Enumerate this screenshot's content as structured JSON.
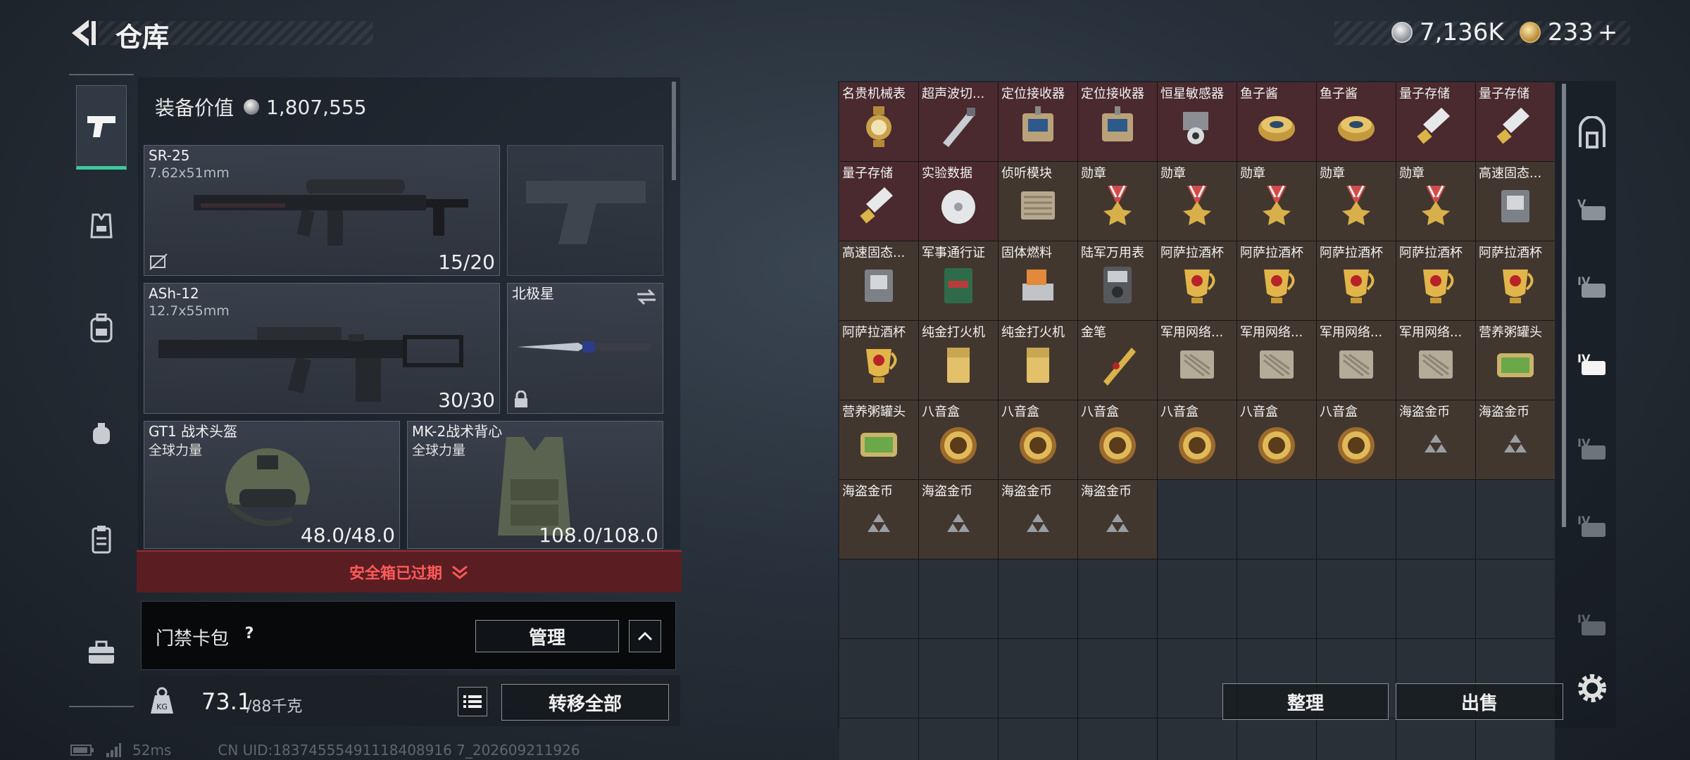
{
  "header": {
    "title": "仓库",
    "currency_1": "7,136K",
    "currency_2": "233",
    "add_label": "+"
  },
  "loadout": {
    "equip_value_label": "装备价值",
    "equip_value": "1,807,555",
    "primary": {
      "name": "SR-25",
      "caliber": "7.62x51mm",
      "ammo": "15/20"
    },
    "secondary": {
      "name": "ASh-12",
      "caliber": "12.7x55mm",
      "ammo": "30/30"
    },
    "melee": {
      "name": "北极星"
    },
    "helmet": {
      "name": "GT1 战术头盔",
      "faction": "全球力量",
      "durability": "48.0/48.0"
    },
    "vest": {
      "name": "MK-2战术背心",
      "faction": "全球力量",
      "durability": "108.0/108.0"
    },
    "safebox_status": "安全箱已过期",
    "card_pack_label": "门禁卡包",
    "card_pack_help": "?",
    "manage_label": "管理",
    "weight_current": "73.1",
    "weight_max": "/88千克",
    "transfer_all_label": "转移全部"
  },
  "storage": {
    "items": [
      {
        "name": "名贵机械表",
        "bg": "red",
        "icon": "watch-icon"
      },
      {
        "name": "超声波切...",
        "bg": "red",
        "icon": "scalpel-icon"
      },
      {
        "name": "定位接收器",
        "bg": "red",
        "icon": "receiver-icon"
      },
      {
        "name": "定位接收器",
        "bg": "red",
        "icon": "receiver-icon"
      },
      {
        "name": "恒星敏感器",
        "bg": "red",
        "icon": "sensor-icon"
      },
      {
        "name": "鱼子酱",
        "bg": "red",
        "icon": "caviar-icon"
      },
      {
        "name": "鱼子酱",
        "bg": "red",
        "icon": "caviar-icon"
      },
      {
        "name": "量子存储",
        "bg": "red",
        "icon": "quantum-storage-icon"
      },
      {
        "name": "量子存储",
        "bg": "red",
        "icon": "quantum-storage-icon"
      },
      {
        "name": "量子存储",
        "bg": "red",
        "icon": "quantum-storage-icon"
      },
      {
        "name": "实验数据",
        "bg": "red",
        "icon": "disc-icon"
      },
      {
        "name": "侦听模块",
        "bg": "brown",
        "icon": "module-icon"
      },
      {
        "name": "勋章",
        "bg": "brown",
        "icon": "medal-icon"
      },
      {
        "name": "勋章",
        "bg": "brown",
        "icon": "medal-icon"
      },
      {
        "name": "勋章",
        "bg": "brown",
        "icon": "medal-icon"
      },
      {
        "name": "勋章",
        "bg": "brown",
        "icon": "medal-icon"
      },
      {
        "name": "勋章",
        "bg": "brown",
        "icon": "medal-icon"
      },
      {
        "name": "高速固态...",
        "bg": "brown",
        "icon": "ssd-icon"
      },
      {
        "name": "高速固态...",
        "bg": "brown",
        "icon": "ssd-icon"
      },
      {
        "name": "军事通行证",
        "bg": "brown",
        "icon": "pass-icon"
      },
      {
        "name": "固体燃料",
        "bg": "brown",
        "icon": "fuel-icon"
      },
      {
        "name": "陆军万用表",
        "bg": "brown",
        "icon": "multimeter-icon"
      },
      {
        "name": "阿萨拉酒杯",
        "bg": "brown",
        "icon": "cup-icon"
      },
      {
        "name": "阿萨拉酒杯",
        "bg": "brown",
        "icon": "cup-icon"
      },
      {
        "name": "阿萨拉酒杯",
        "bg": "brown",
        "icon": "cup-icon"
      },
      {
        "name": "阿萨拉酒杯",
        "bg": "brown",
        "icon": "cup-icon"
      },
      {
        "name": "阿萨拉酒杯",
        "bg": "brown",
        "icon": "cup-icon"
      },
      {
        "name": "阿萨拉酒杯",
        "bg": "brown",
        "icon": "cup-icon"
      },
      {
        "name": "纯金打火机",
        "bg": "brown",
        "icon": "lighter-icon"
      },
      {
        "name": "纯金打火机",
        "bg": "brown",
        "icon": "lighter-icon"
      },
      {
        "name": "金笔",
        "bg": "brown",
        "icon": "pen-icon"
      },
      {
        "name": "军用网络...",
        "bg": "brown",
        "icon": "network-module-icon"
      },
      {
        "name": "军用网络...",
        "bg": "brown",
        "icon": "network-module-icon"
      },
      {
        "name": "军用网络...",
        "bg": "brown",
        "icon": "network-module-icon"
      },
      {
        "name": "军用网络...",
        "bg": "brown",
        "icon": "network-module-icon"
      },
      {
        "name": "营养粥罐头",
        "bg": "brown",
        "icon": "can-icon"
      },
      {
        "name": "营养粥罐头",
        "bg": "brown",
        "icon": "can-icon"
      },
      {
        "name": "八音盒",
        "bg": "brown",
        "icon": "music-box-icon"
      },
      {
        "name": "八音盒",
        "bg": "brown",
        "icon": "music-box-icon"
      },
      {
        "name": "八音盒",
        "bg": "brown",
        "icon": "music-box-icon"
      },
      {
        "name": "八音盒",
        "bg": "brown",
        "icon": "music-box-icon"
      },
      {
        "name": "八音盒",
        "bg": "brown",
        "icon": "music-box-icon"
      },
      {
        "name": "八音盒",
        "bg": "brown",
        "icon": "music-box-icon"
      },
      {
        "name": "海盗金币",
        "bg": "brown",
        "icon": "coin-pile-icon"
      },
      {
        "name": "海盗金币",
        "bg": "brown",
        "icon": "coin-pile-icon"
      },
      {
        "name": "海盗金币",
        "bg": "brown",
        "icon": "coin-pile-icon"
      },
      {
        "name": "海盗金币",
        "bg": "brown",
        "icon": "coin-pile-icon"
      },
      {
        "name": "海盗金币",
        "bg": "brown",
        "icon": "coin-pile-icon"
      },
      {
        "name": "海盗金币",
        "bg": "brown",
        "icon": "coin-pile-icon"
      }
    ],
    "empty_cells": 32,
    "sort_label": "整理",
    "sell_label": "出售"
  },
  "status": {
    "ping": "52ms",
    "uid": "CN UID:18374555491118408916 7_202609211926"
  },
  "colors": {
    "accent_green": "#3ec99a",
    "danger_red": "#ff5a5a",
    "rare_red_bg": "#4a2a2e",
    "brown_bg": "#42372f"
  }
}
